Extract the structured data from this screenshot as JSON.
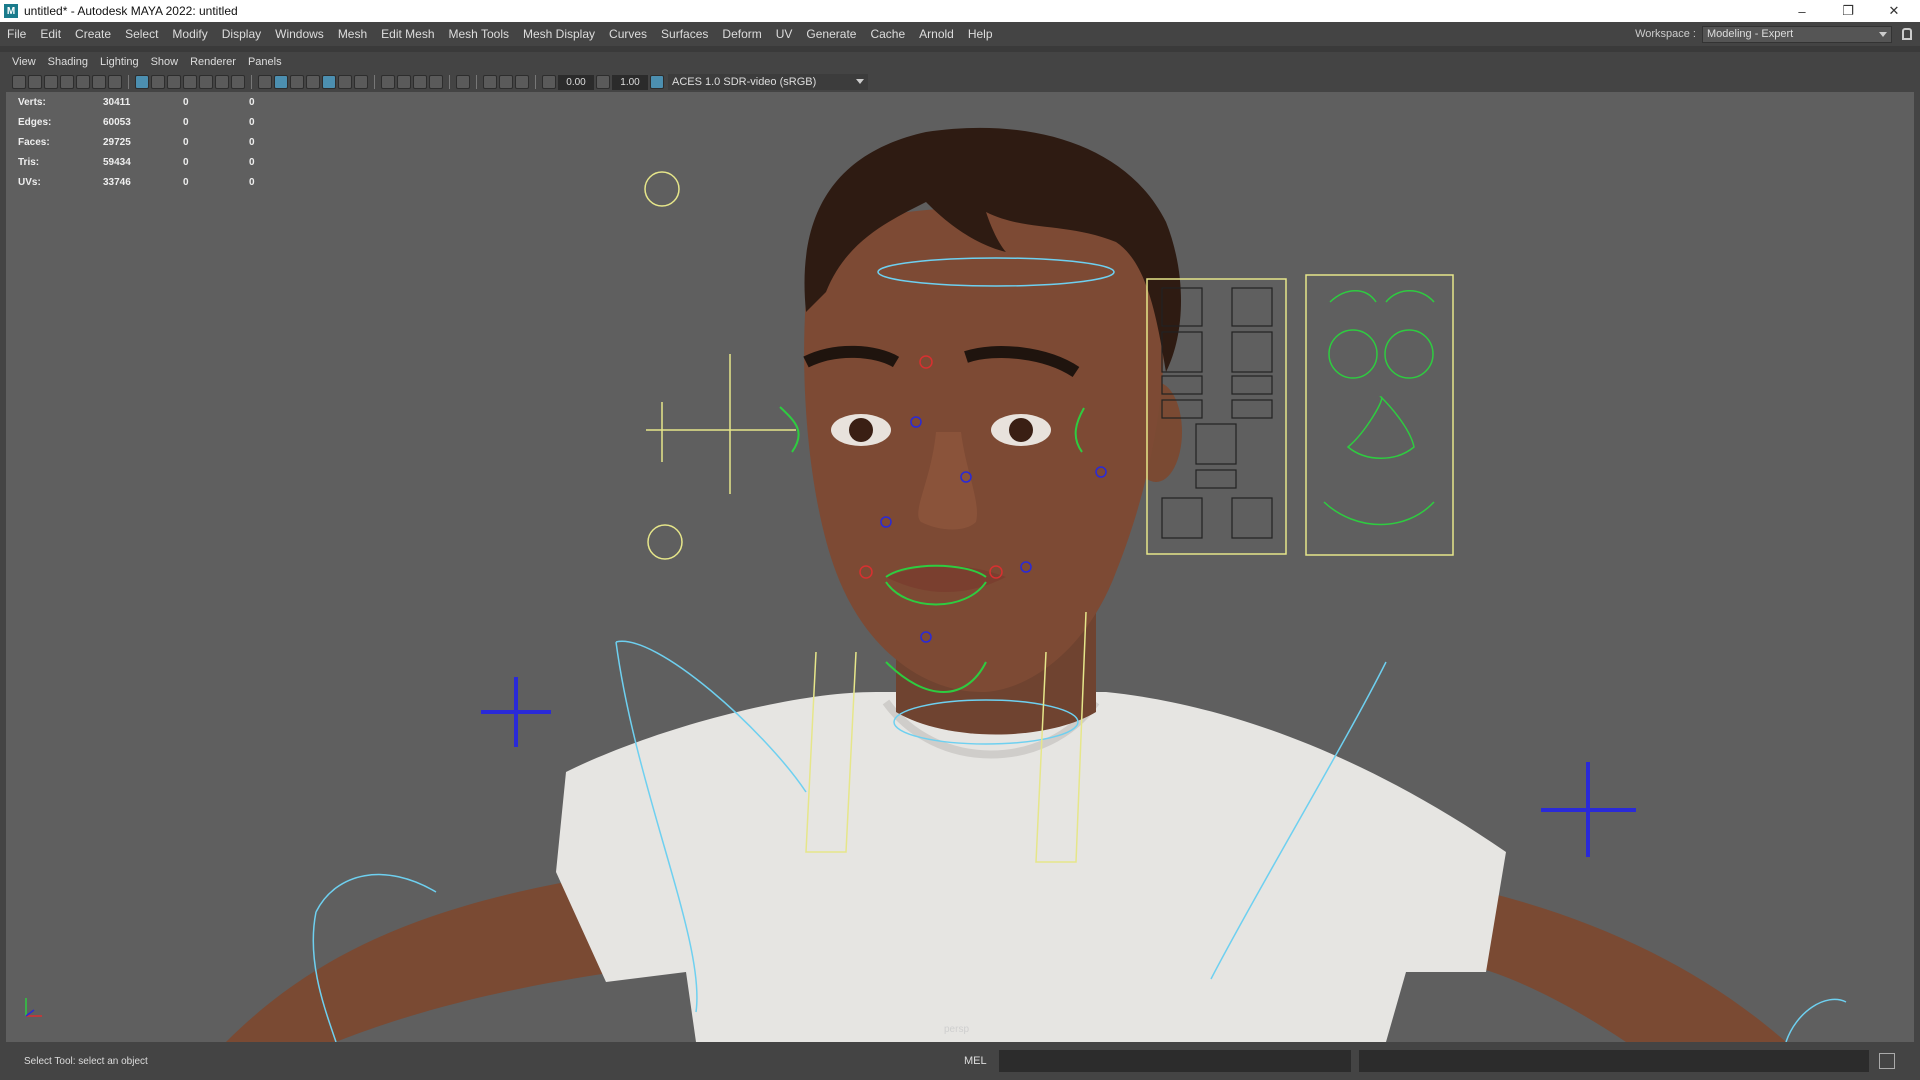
{
  "window": {
    "title": "untitled* - Autodesk MAYA 2022: untitled",
    "logo": "M",
    "controls": [
      "–",
      "❐",
      "✕"
    ]
  },
  "menu": [
    "File",
    "Edit",
    "Create",
    "Select",
    "Modify",
    "Display",
    "Windows",
    "Mesh",
    "Edit Mesh",
    "Mesh Tools",
    "Mesh Display",
    "Curves",
    "Surfaces",
    "Deform",
    "UV",
    "Generate",
    "Cache",
    "Arnold",
    "Help"
  ],
  "workspace": {
    "label": "Workspace :",
    "value": "Modeling - Expert"
  },
  "panel_menu": [
    "View",
    "Shading",
    "Lighting",
    "Show",
    "Renderer",
    "Panels"
  ],
  "panel_toolbar": {
    "exposure": "0.00",
    "gamma": "1.00",
    "color_space": "ACES 1.0 SDR-video (sRGB)"
  },
  "hud": {
    "rows": [
      {
        "label": "Verts:",
        "total": "30411",
        "sel": "0",
        "comp": "0"
      },
      {
        "label": "Edges:",
        "total": "60053",
        "sel": "0",
        "comp": "0"
      },
      {
        "label": "Faces:",
        "total": "29725",
        "sel": "0",
        "comp": "0"
      },
      {
        "label": "Tris:",
        "total": "59434",
        "sel": "0",
        "comp": "0"
      },
      {
        "label": "UVs:",
        "total": "33746",
        "sel": "0",
        "comp": "0"
      }
    ]
  },
  "viewport": {
    "camera": "persp",
    "scene": "Rigged character head and torso with facial controls"
  },
  "status": {
    "help_line": "Select Tool: select an object",
    "command_mode": "MEL"
  },
  "colors": {
    "viewport_bg": "#5f5f5f",
    "ui_bg": "#444444",
    "control_yellow": "#e6e68a",
    "control_green": "#2ecc40",
    "control_blue": "#2a2ad8",
    "control_cyan": "#6ed0f0",
    "control_red": "#d83030"
  }
}
